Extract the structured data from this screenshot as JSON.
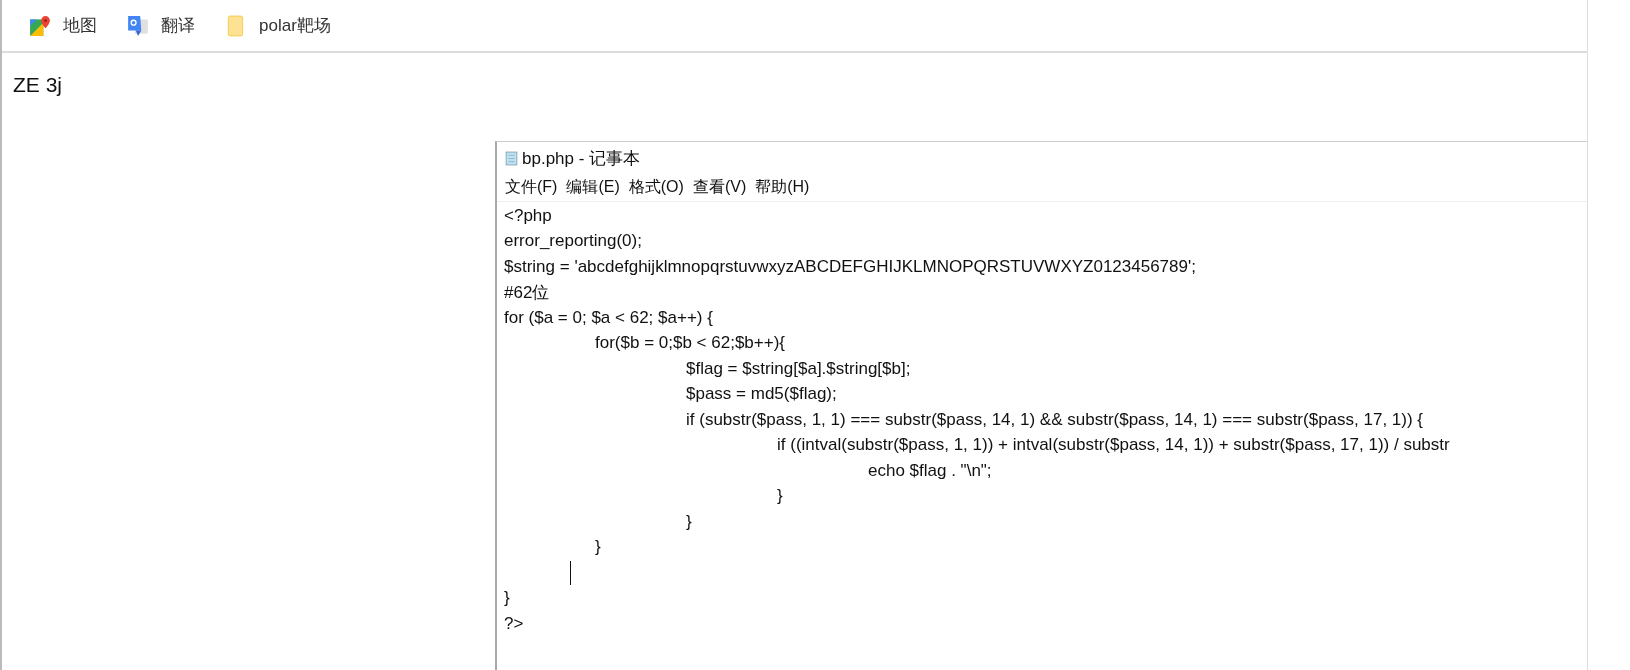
{
  "bookmarks": [
    {
      "label": "地图",
      "kind": "maps"
    },
    {
      "label": "翻译",
      "kind": "translate"
    },
    {
      "label": "polar靶场",
      "kind": "folder"
    }
  ],
  "page_text": "ZE 3j",
  "notepad": {
    "title": "bp.php - 记事本",
    "menu": [
      "文件(F)",
      "编辑(E)",
      "格式(O)",
      "查看(V)",
      "帮助(H)"
    ],
    "lines": [
      {
        "text": "<?php"
      },
      {
        "text": "error_reporting(0);"
      },
      {
        "text": "$string = 'abcdefghijklmnopqrstuvwxyzABCDEFGHIJKLMNOPQRSTUVWXYZ0123456789';"
      },
      {
        "text": "#62位"
      },
      {
        "text": "for ($a = 0; $a < 62; $a++) {"
      },
      {
        "text": "\tfor($b = 0;$b < 62;$b++){"
      },
      {
        "text": "\t\t$flag = $string[$a].$string[$b];"
      },
      {
        "text": "\t\t$pass = md5($flag);"
      },
      {
        "text": "\t\tif (substr($pass, 1, 1) === substr($pass, 14, 1) && substr($pass, 14, 1) === substr($pass, 17, 1)) {"
      },
      {
        "text": "\t\t\tif ((intval(substr($pass, 1, 1)) + intval(substr($pass, 14, 1)) + substr($pass, 17, 1)) / substr"
      },
      {
        "text": "\t\t\t\techo $flag . \"\\n\";"
      },
      {
        "text": "\t\t\t}"
      },
      {
        "text": "\t\t}"
      },
      {
        "text": "\t}"
      },
      {
        "caret": true
      },
      {
        "text": "}"
      },
      {
        "text": "?>"
      }
    ]
  }
}
